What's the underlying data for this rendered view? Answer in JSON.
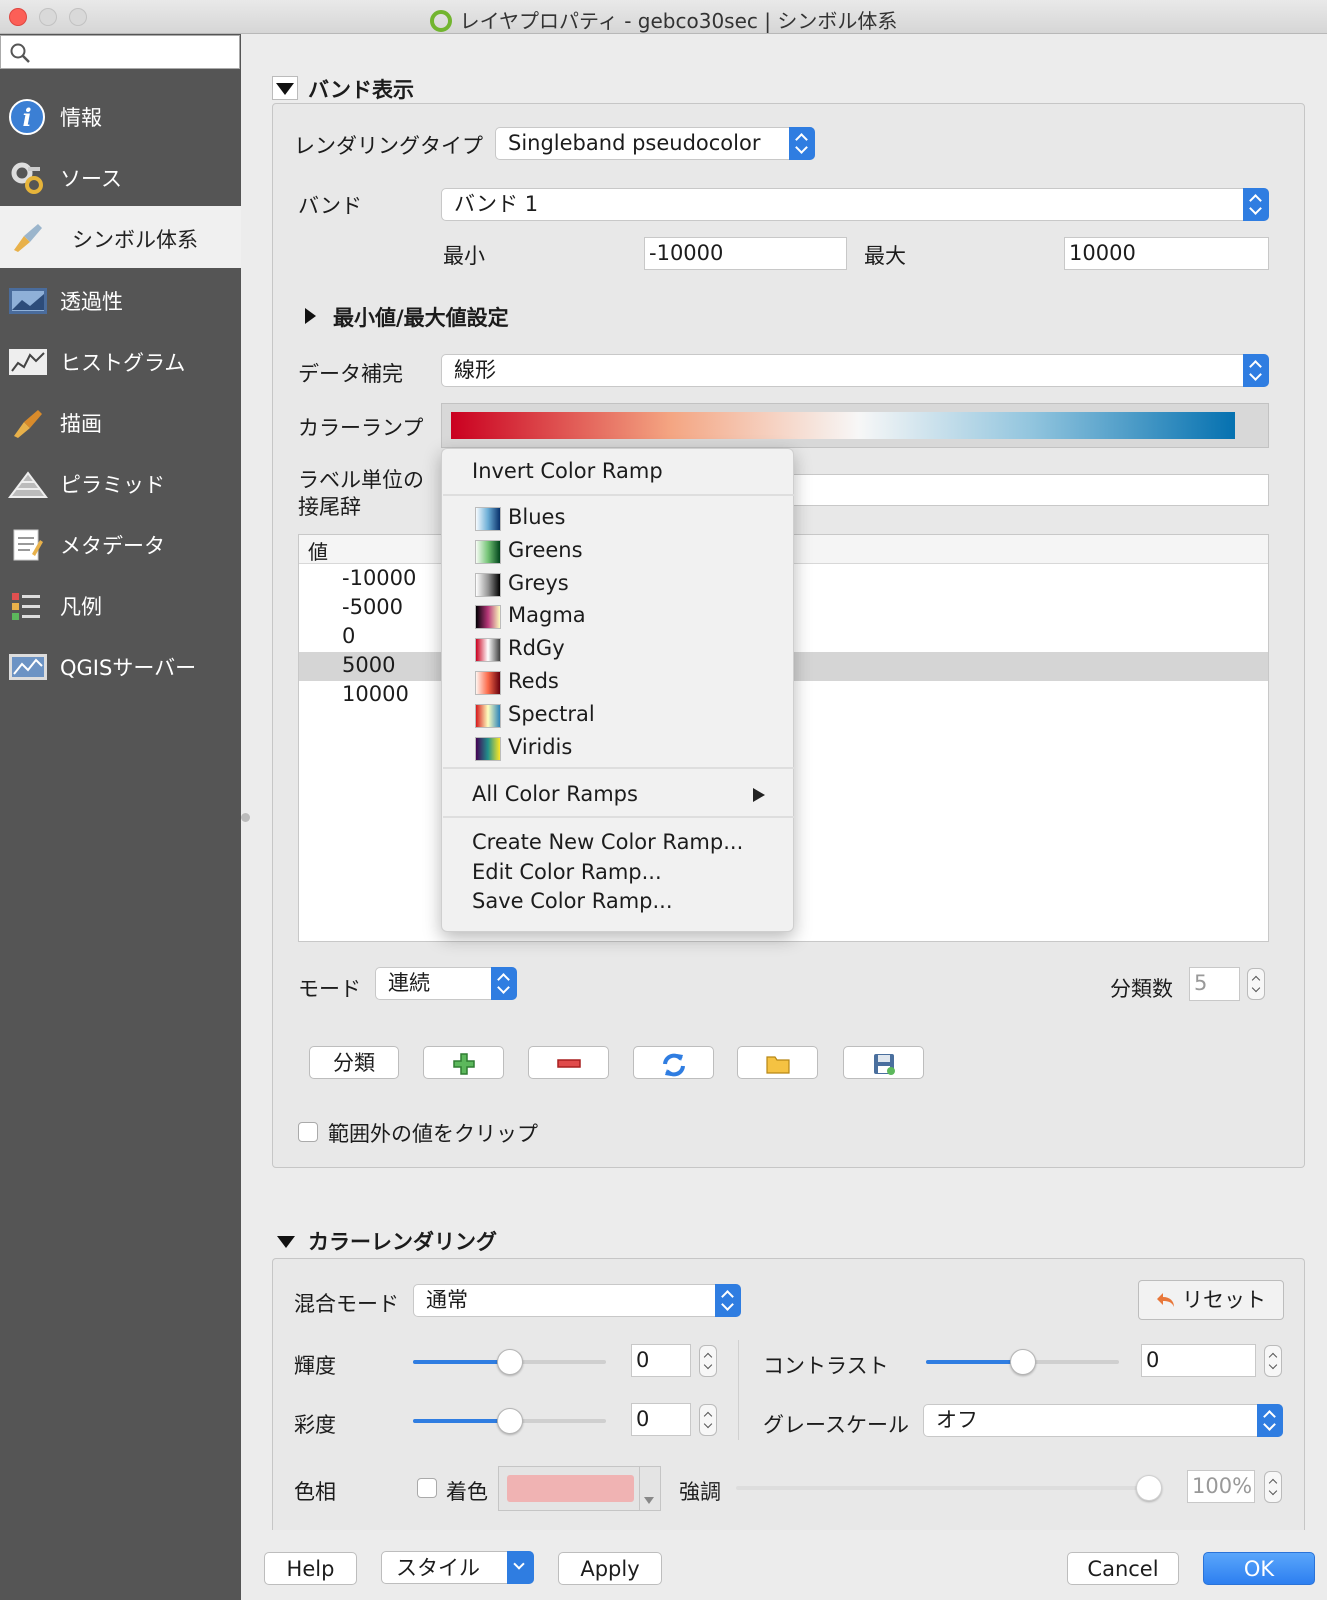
{
  "window": {
    "title": "レイヤプロパティ - gebco30sec | シンボル体系"
  },
  "search": {
    "placeholder": ""
  },
  "sidebar": {
    "items": [
      {
        "label": "情報",
        "icon": "info-icon"
      },
      {
        "label": "ソース",
        "icon": "source-icon"
      },
      {
        "label": "シンボル体系",
        "icon": "paintbrush-icon",
        "selected": true
      },
      {
        "label": "透過性",
        "icon": "transparency-icon"
      },
      {
        "label": "ヒストグラム",
        "icon": "histogram-icon"
      },
      {
        "label": "描画",
        "icon": "render-icon"
      },
      {
        "label": "ピラミッド",
        "icon": "pyramid-icon"
      },
      {
        "label": "メタデータ",
        "icon": "metadata-icon"
      },
      {
        "label": "凡例",
        "icon": "legend-icon"
      },
      {
        "label": "QGISサーバー",
        "icon": "server-icon"
      }
    ]
  },
  "band": {
    "header": "バンド表示",
    "render_type_label": "レンダリングタイプ",
    "render_type_value": "Singleband pseudocolor",
    "band_label": "バンド",
    "band_value": "バンド 1",
    "min_label": "最小",
    "min_value": "-10000",
    "max_label": "最大",
    "max_value": "10000",
    "minmax_header": "最小値/最大値設定",
    "interp_label": "データ補完",
    "interp_value": "線形",
    "ramp_label": "カラーランプ",
    "suffix_label_1": "ラベル単位の",
    "suffix_label_2": "接尾辞",
    "suffix_value": "",
    "table": {
      "col_value": "値",
      "rows": [
        "-10000",
        "-5000",
        "0",
        "5000",
        "10000"
      ],
      "selected_row": 3
    },
    "mode_label": "モード",
    "mode_value": "連続",
    "classes_label": "分類数",
    "classes_value": "5",
    "classify_btn": "分類",
    "clip_label": "範囲外の値をクリップ"
  },
  "menu": {
    "invert": "Invert Color Ramp",
    "ramps": [
      {
        "name": "Blues",
        "colors": [
          "#f7fbff",
          "#6baed6",
          "#08306b"
        ]
      },
      {
        "name": "Greens",
        "colors": [
          "#f7fcf5",
          "#74c476",
          "#00441b"
        ]
      },
      {
        "name": "Greys",
        "colors": [
          "#ffffff",
          "#969696",
          "#000000"
        ]
      },
      {
        "name": "Magma",
        "colors": [
          "#000004",
          "#b73779",
          "#fcfdbf"
        ]
      },
      {
        "name": "RdGy",
        "colors": [
          "#ca0020",
          "#ffffff",
          "#404040"
        ]
      },
      {
        "name": "Reds",
        "colors": [
          "#fff5f0",
          "#fb6a4a",
          "#67000d"
        ]
      },
      {
        "name": "Spectral",
        "colors": [
          "#d7191c",
          "#ffffbf",
          "#2b83ba"
        ]
      },
      {
        "name": "Viridis",
        "colors": [
          "#440154",
          "#21918c",
          "#fde725"
        ]
      }
    ],
    "all_ramps": "All Color Ramps",
    "create": "Create New Color Ramp...",
    "edit": "Edit Color Ramp...",
    "save": "Save Color Ramp..."
  },
  "color_rendering": {
    "header": "カラーレンダリング",
    "blend_label": "混合モード",
    "blend_value": "通常",
    "reset_btn": "リセット",
    "brightness_label": "輝度",
    "brightness_value": "0",
    "contrast_label": "コントラスト",
    "contrast_value": "0",
    "saturation_label": "彩度",
    "saturation_value": "0",
    "grayscale_label": "グレースケール",
    "grayscale_value": "オフ",
    "hue_label": "色相",
    "colorize_label": "着色",
    "strength_label": "強調",
    "strength_value": "100%",
    "colorize_swatch": "#f0b3b3"
  },
  "footer": {
    "help": "Help",
    "style": "スタイル",
    "apply": "Apply",
    "cancel": "Cancel",
    "ok": "OK"
  },
  "colors": {
    "accent": "#2f7de1",
    "sidebar_bg": "#555555",
    "ramp_start": "#ca0020",
    "ramp_mid": "#f7f7f7",
    "ramp_end": "#0571b0"
  }
}
